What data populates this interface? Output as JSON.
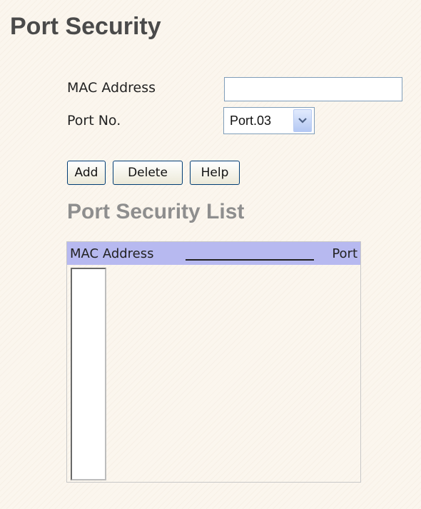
{
  "page": {
    "title": "Port Security"
  },
  "form": {
    "mac_label": "MAC Address",
    "mac_value": "",
    "port_label": "Port No.",
    "port_selected": "Port.03"
  },
  "buttons": {
    "add": "Add",
    "delete": "Delete",
    "help": "Help"
  },
  "list": {
    "title": "Port Security List",
    "header_mac": "MAC Address",
    "header_port": "Port",
    "items": []
  },
  "colors": {
    "header_bg": "#b7b9f0",
    "title": "#4a4a4a",
    "subtitle": "#8e8e8e"
  }
}
